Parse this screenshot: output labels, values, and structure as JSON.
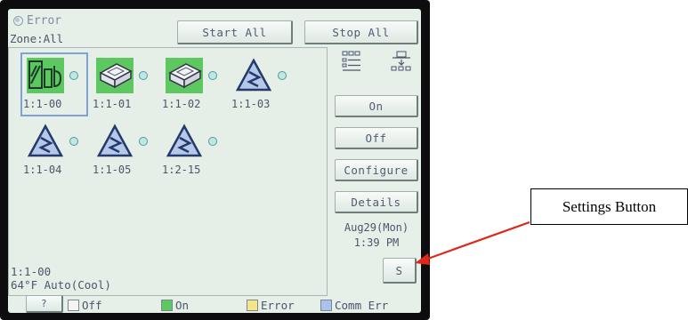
{
  "header": {
    "error_label": "Error",
    "start_all_label": "Start All",
    "stop_all_label": "Stop All"
  },
  "zone_label": "Zone:All",
  "units": [
    {
      "id": "1:1-00",
      "state": "on",
      "icon": "unit-type-icon",
      "selected": true
    },
    {
      "id": "1:1-01",
      "state": "on",
      "icon": "cassette-unit-icon",
      "selected": false
    },
    {
      "id": "1:1-02",
      "state": "on",
      "icon": "cassette-unit-icon",
      "selected": false
    },
    {
      "id": "1:1-03",
      "state": "comm-err",
      "icon": "warning-triangle-icon",
      "selected": false
    },
    {
      "id": "1:1-04",
      "state": "comm-err",
      "icon": "warning-triangle-icon",
      "selected": false
    },
    {
      "id": "1:1-05",
      "state": "comm-err",
      "icon": "warning-triangle-icon",
      "selected": false
    },
    {
      "id": "1:2-15",
      "state": "comm-err",
      "icon": "warning-triangle-icon",
      "selected": false
    }
  ],
  "status": {
    "selected_unit": "1:1-00",
    "temp_mode": "64°F  Auto(Cool)"
  },
  "side": {
    "list_view_icon": "list-view-icon",
    "group_view_icon": "group-tree-icon",
    "on_label": "On",
    "off_label": "Off",
    "configure_label": "Configure",
    "details_label": "Details",
    "date": "Aug29(Mon)",
    "time": "1:39 PM",
    "settings_label": "S"
  },
  "legend": {
    "help_label": "?",
    "items": [
      {
        "label": "Off",
        "color": "#f4f4f4"
      },
      {
        "label": "On",
        "color": "#5cc85f"
      },
      {
        "label": "Error",
        "color": "#f6e48a"
      },
      {
        "label": "Comm Err",
        "color": "#a9c3ec"
      }
    ]
  },
  "annotation": {
    "callout_text": "Settings Button",
    "arrow_color": "#e1261c"
  }
}
